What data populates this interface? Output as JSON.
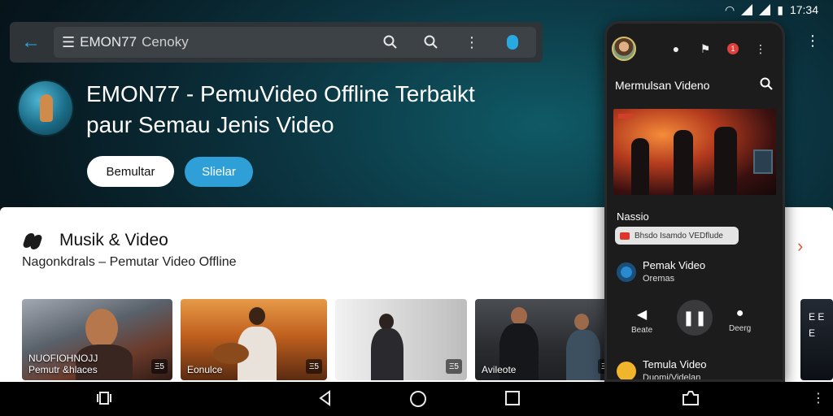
{
  "status_bar": {
    "time": "17:34"
  },
  "topbar": {
    "search_menu_glyph": "☰",
    "search_text": "EMON77",
    "search_query": "Cenoky",
    "icons": [
      "search-icon",
      "search-icon",
      "more-vert-icon",
      "mic-icon"
    ]
  },
  "hero": {
    "title_line1": "EMON77 - PemuVideo Offline Terbaikt",
    "title_line2": "paur Semau Jenis Video",
    "primary_button": "Bemultar",
    "secondary_button": "Slielar"
  },
  "card": {
    "title": "Musik & Video",
    "subtitle": "Nagonkdrals – Pemutar Video Offline",
    "thumbnails": [
      {
        "caption_line1": "NUOFIOHNOJJ",
        "caption_line2": "Pemutr &hlaces",
        "badge": "Ξ5"
      },
      {
        "caption_line1": "",
        "caption_line2": "Eonulce",
        "badge": "Ξ5"
      },
      {
        "caption_line1": "",
        "caption_line2": "",
        "badge": "Ξ5"
      },
      {
        "caption_line1": "",
        "caption_line2": "Avileote",
        "badge": "Ξ5"
      }
    ],
    "right_partial_text": "E E E"
  },
  "phone": {
    "header_icons": [
      "record-icon",
      "flag-icon",
      "notification-icon",
      "more-vert-icon"
    ],
    "notification_badge": "1",
    "title": "Mermulsan Videno",
    "video_label": "Nassio",
    "chip_text": "Bhsdo Isamdo VEDflude",
    "row1_title": "Pemak Video",
    "row1_sub": "Oremas",
    "controls": {
      "left_label": "Beate",
      "right_label": "Deerg"
    },
    "row2_title": "Temula Video",
    "row2_sub": "Duomi/Videlan"
  },
  "navbar": {
    "icons": [
      "recents-icon",
      "back-icon",
      "home-icon",
      "overview-icon",
      "screenshot-icon",
      "more-icon"
    ]
  }
}
